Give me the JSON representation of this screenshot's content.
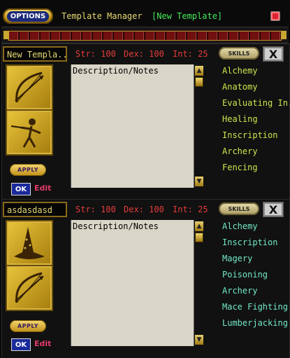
{
  "header": {
    "options_label": "OPTIONS",
    "title": "Template Manager",
    "template_title": "[New Template]"
  },
  "stat_labels": {
    "str": "Str:",
    "dex": "Dex:",
    "int": "Int:"
  },
  "templates": [
    {
      "name": "New Templa...",
      "stats": {
        "str": "100",
        "dex": "100",
        "int": "25"
      },
      "skills_label": "SKILLS",
      "close_label": "X",
      "notes_placeholder": "Description/Notes",
      "apply_label": "APPLY",
      "ok_label": "OK",
      "edit_label": "Edit",
      "skill_color": "#cce54d",
      "skills": [
        "Alchemy",
        "Anatomy",
        "Evaluating In...",
        "Healing",
        "Inscription",
        "Archery",
        "Fencing"
      ],
      "icons": [
        "bow-and-arrow-icon",
        "fencer-icon"
      ]
    },
    {
      "name": "asdasdasd",
      "stats": {
        "str": "100",
        "dex": "100",
        "int": "25"
      },
      "skills_label": "SKILLS",
      "close_label": "X",
      "notes_placeholder": "Description/Notes",
      "apply_label": "APPLY",
      "ok_label": "OK",
      "edit_label": "Edit",
      "skill_color": "#72e8c8",
      "skills": [
        "Alchemy",
        "Inscription",
        "Magery",
        "Poisoning",
        "Archery",
        "Mace Fighting",
        "Lumberjacking"
      ],
      "icons": [
        "wizard-hat-icon",
        "bow-and-arrow-icon"
      ]
    }
  ],
  "colors": {
    "stat_red": "#e53c3c",
    "title_yellow": "#e6d870",
    "template_green": "#46e85a",
    "edit_pink": "#e23b6a"
  }
}
